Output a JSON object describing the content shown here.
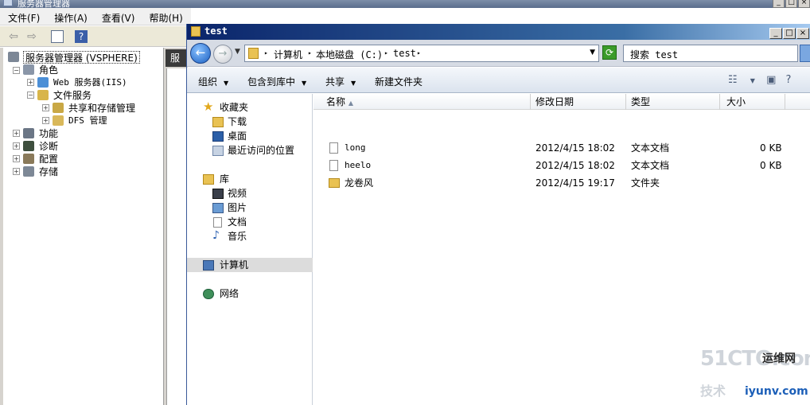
{
  "server_manager": {
    "title": "服务器管理器",
    "menu": [
      "文件(F)",
      "操作(A)",
      "查看(V)",
      "帮助(H)"
    ],
    "tree": {
      "root": "服务器管理器 (VSPHERE)",
      "roles": "角色",
      "web_server": "Web 服务器(IIS)",
      "file_services": "文件服务",
      "share_storage": "共享和存储管理",
      "dfs": "DFS 管理",
      "features": "功能",
      "diagnostics": "诊断",
      "configuration": "配置",
      "storage": "存储"
    },
    "right_tab": "服"
  },
  "explorer": {
    "title": "test",
    "address": {
      "crumbs": [
        "计算机",
        "本地磁盘 (C:)",
        "test"
      ]
    },
    "search": {
      "placeholder": "搜索 test"
    },
    "toolbar": {
      "organize": "组织",
      "include_library": "包含到库中",
      "share": "共享",
      "new_folder": "新建文件夹"
    },
    "nav": {
      "favorites": "收藏夹",
      "downloads": "下载",
      "desktop": "桌面",
      "recent": "最近访问的位置",
      "libraries": "库",
      "videos": "视频",
      "pictures": "图片",
      "documents": "文档",
      "music": "音乐",
      "computer": "计算机",
      "network": "网络"
    },
    "columns": {
      "name": "名称",
      "modified": "修改日期",
      "type": "类型",
      "size": "大小"
    },
    "files": [
      {
        "name": "long",
        "modified": "2012/4/15 18:02",
        "type": "文本文档",
        "size": "0 KB"
      },
      {
        "name": "heelo",
        "modified": "2012/4/15 18:02",
        "type": "文本文档",
        "size": "0 KB"
      },
      {
        "name": "龙卷风",
        "modified": "2012/4/15 19:17",
        "type": "文件夹",
        "size": ""
      }
    ]
  },
  "watermark": {
    "logo": "51CTO.com",
    "brand": "运维网",
    "domain": "iyunv.com",
    "sub": "技术"
  }
}
